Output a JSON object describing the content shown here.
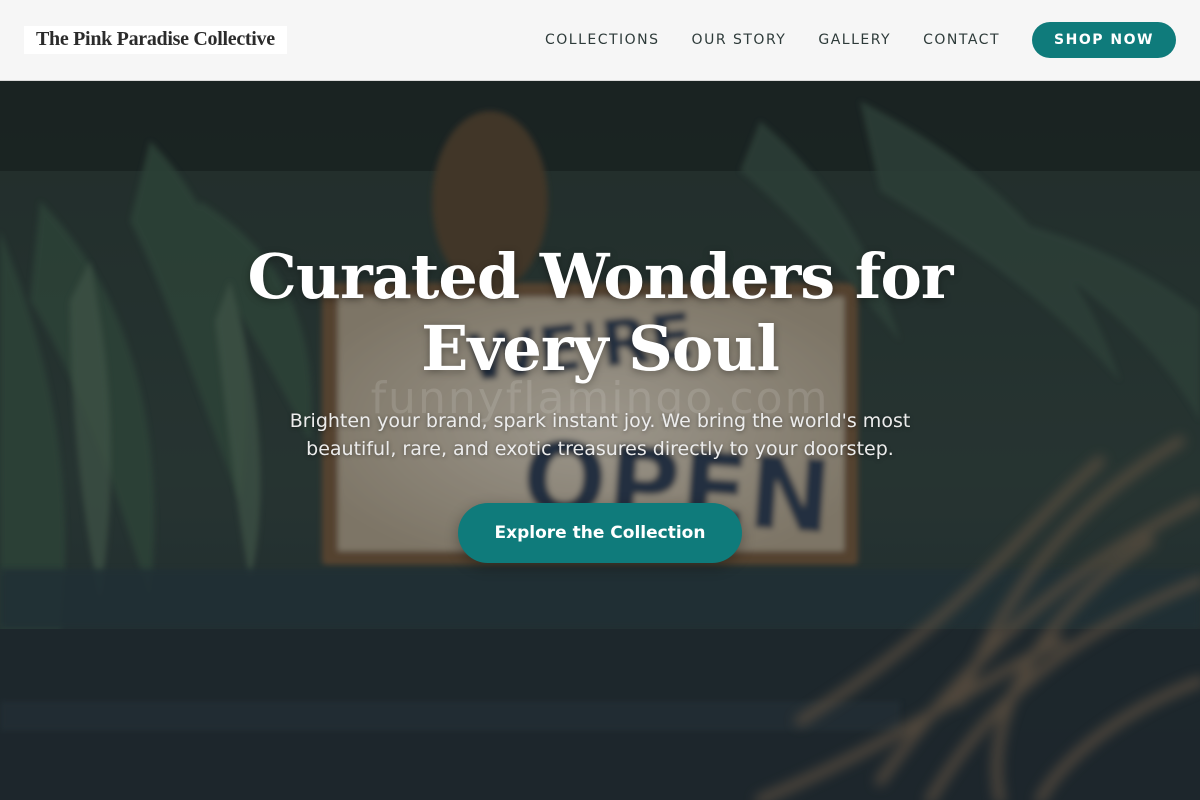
{
  "header": {
    "logo": "The Pink Paradise Collective",
    "nav": [
      "COLLECTIONS",
      "OUR STORY",
      "GALLERY",
      "CONTACT"
    ],
    "cta": "SHOP NOW"
  },
  "hero": {
    "title": "Curated Wonders for Every Soul",
    "subtitle": "Brighten your brand, spark instant joy. We bring the world's most beautiful, rare, and exotic treasures directly to your doorstep.",
    "cta": "Explore the Collection",
    "sign_text_top": "WE'RE",
    "sign_text_bottom": "OPEN",
    "watermark": "funnyflamingo.com"
  },
  "colors": {
    "accent": "#0f7b7b",
    "header_bg": "#f6f6f6",
    "nav_text": "#2e3b3a"
  }
}
